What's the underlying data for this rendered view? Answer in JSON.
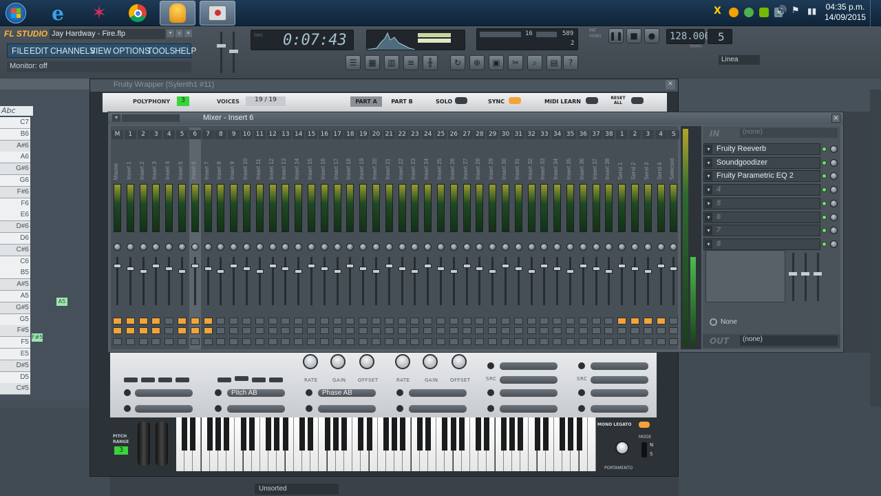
{
  "taskbar": {
    "time": "04:35 p.m.",
    "date": "14/09/2015",
    "apps": [
      "windows-start",
      "internet-explorer",
      "app-star",
      "chrome",
      "fl-studio",
      "app-tools"
    ]
  },
  "fl": {
    "logo": "FL STUDIO",
    "project_title": "Jay Hardway - Fire.flp",
    "menu": [
      "FILE",
      "EDIT",
      "CHANNELS",
      "VIEW",
      "OPTIONS",
      "TOOLS",
      "HELP"
    ],
    "hint": "Monitor: off",
    "time_display": "0:07:43",
    "tempo": "128.000",
    "pattern": "5",
    "cpu_value": "16",
    "ram_value": "589",
    "poly_value": "2",
    "snap": "Linea",
    "panel_mini_labels": {
      "tempo": "TEMPO",
      "pat": "PAT",
      "song": "SONG"
    }
  },
  "wrapper": {
    "title": "Fruity Wrapper (Sylenth1 #11)",
    "polyphony_label": "POLYPHONY",
    "polyphony_value": "3",
    "voices_label": "VOICES",
    "voices_value": "19  /  19",
    "part_a": "PART A",
    "part_b": "PART B",
    "solo": "SOLO",
    "sync": "SYNC",
    "midi_learn": "MIDI LEARN",
    "reset_all": "RESET ALL"
  },
  "mixer": {
    "title": "Mixer - Insert 6",
    "strip_labels": [
      "Master",
      "Insert 1",
      "Insert 2",
      "Insert 3",
      "Insert 4",
      "Insert 5",
      "Insert 6",
      "Insert 7",
      "Insert 8",
      "Insert 9",
      "Insert 10",
      "Insert 11",
      "Insert 12",
      "Insert 13",
      "Insert 14",
      "Insert 15",
      "Insert 16",
      "Insert 17",
      "Insert 18",
      "Insert 19",
      "Insert 20",
      "Insert 21",
      "Insert 22",
      "Insert 23",
      "Insert 24",
      "Insert 25",
      "Insert 26",
      "Insert 27",
      "Insert 28",
      "Insert 29",
      "Insert 30",
      "Insert 31",
      "Insert 32",
      "Insert 33",
      "Insert 34",
      "Insert 35",
      "Insert 36",
      "Insert 37",
      "Insert 38",
      "Send 1",
      "Send 2",
      "Send 3",
      "Send 4",
      "Selected"
    ],
    "strip_numbers": [
      "M",
      "1",
      "2",
      "3",
      "4",
      "5",
      "6",
      "7",
      "8",
      "9",
      "10",
      "11",
      "12",
      "13",
      "14",
      "15",
      "16",
      "17",
      "18",
      "19",
      "20",
      "21",
      "22",
      "23",
      "24",
      "25",
      "26",
      "27",
      "28",
      "29",
      "30",
      "31",
      "32",
      "33",
      "34",
      "35",
      "36",
      "37",
      "38",
      "1",
      "2",
      "3",
      "4",
      "S"
    ],
    "in_label": "IN",
    "in_value": "(none)",
    "effects": [
      "Fruity Reeverb",
      "Soundgoodizer",
      "Fruity Parametric EQ 2",
      "4",
      "5",
      "6",
      "7",
      "8"
    ],
    "eq_preset": "None",
    "out_label": "OUT",
    "out_value": "(none)"
  },
  "synth": {
    "knob_labels": [
      "RATE",
      "GAIN",
      "OFFSET",
      "RATE",
      "GAIN",
      "OFFSET"
    ],
    "pitch_ab": "Pitch AB",
    "phase_ab": "Phase AB",
    "src1": "SRC",
    "src2": "SRC",
    "pitch_range": "PITCH RANGE",
    "pitch_range_value": "3",
    "mono_legato": "MONO LEGATO",
    "mode": "MODE",
    "portamento": "PORTAMENTO",
    "mode_letters": [
      "N",
      "S"
    ]
  },
  "pianoroll": {
    "keys": [
      "C7",
      "B6",
      "A#6",
      "A6",
      "G#6",
      "G6",
      "F#6",
      "F6",
      "E6",
      "D#6",
      "D6",
      "C#6",
      "C6",
      "B5",
      "A#5",
      "A5",
      "G#5",
      "G5",
      "F#5",
      "F5",
      "E5",
      "D#5",
      "D5",
      "C#5"
    ],
    "notes": [
      "A5",
      "F#5"
    ]
  },
  "bottom": {
    "browser_label": "Unsorted"
  }
}
